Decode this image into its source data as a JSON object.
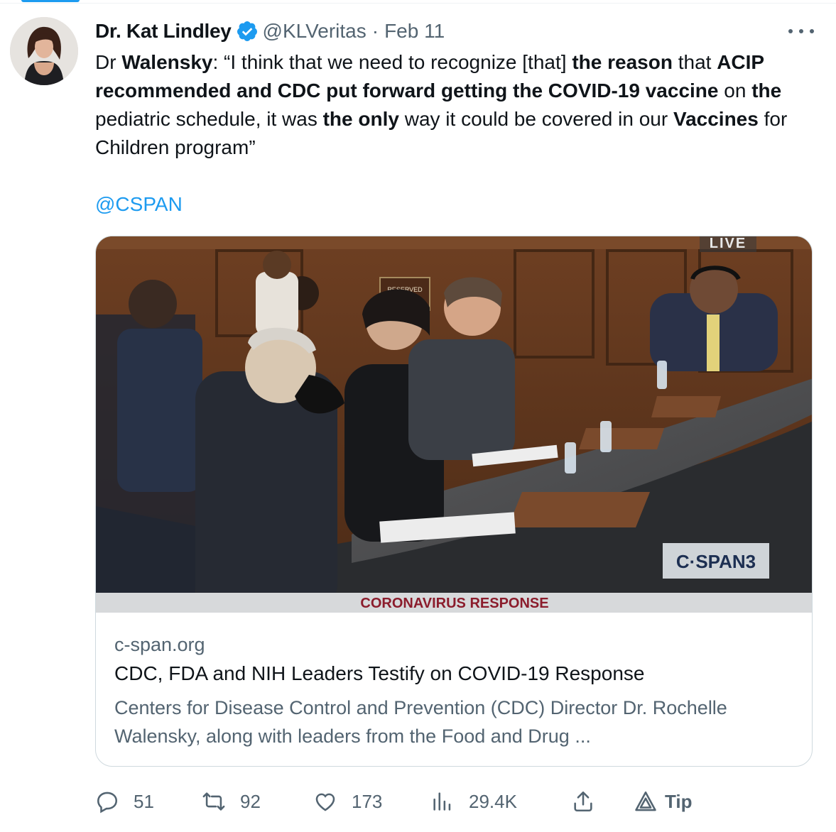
{
  "tweet": {
    "author_name": "Dr. Kat Lindley",
    "handle": "@KLVeritas",
    "separator": "·",
    "date": "Feb 11",
    "text_segments": [
      {
        "t": "Dr ",
        "b": false
      },
      {
        "t": "Walensky",
        "b": true
      },
      {
        "t": ": “I think that we need to recognize [that] ",
        "b": false
      },
      {
        "t": "the reason",
        "b": true
      },
      {
        "t": " that ",
        "b": false
      },
      {
        "t": "ACIP recommended and CDC put forward getting the COVID-19 vaccine",
        "b": true
      },
      {
        "t": " on ",
        "b": false
      },
      {
        "t": "the",
        "b": true
      },
      {
        "t": " pediatric schedule, it was ",
        "b": false
      },
      {
        "t": "the only",
        "b": true
      },
      {
        "t": " way it could be covered in our ",
        "b": false
      },
      {
        "t": "Vaccines",
        "b": true
      },
      {
        "t": " for Children program”",
        "b": false
      }
    ],
    "mention": "@CSPAN"
  },
  "card": {
    "media": {
      "live_label": "LIVE",
      "network_logo": "C·SPAN3",
      "lower_third": "Coronavirus Response",
      "placard_text": "RESERVED"
    },
    "domain": "c-span.org",
    "title": "CDC, FDA and NIH Leaders Testify on COVID-19 Response",
    "description": "Centers for Disease Control and Prevention (CDC) Director Dr. Rochelle Walensky, along with leaders from the Food and Drug ..."
  },
  "actions": {
    "replies": "51",
    "retweets": "92",
    "likes": "173",
    "views": "29.4K",
    "tip_label": "Tip"
  },
  "colors": {
    "accent": "#1d9bf0",
    "secondary_text": "#536471",
    "primary_text": "#0f1419",
    "border": "#cfd9de",
    "lower_third_text": "#8b1c2c"
  },
  "icons": [
    "verified-badge-icon",
    "more-options-icon",
    "reply-icon",
    "retweet-icon",
    "like-icon",
    "views-icon",
    "share-icon",
    "tip-icon"
  ]
}
